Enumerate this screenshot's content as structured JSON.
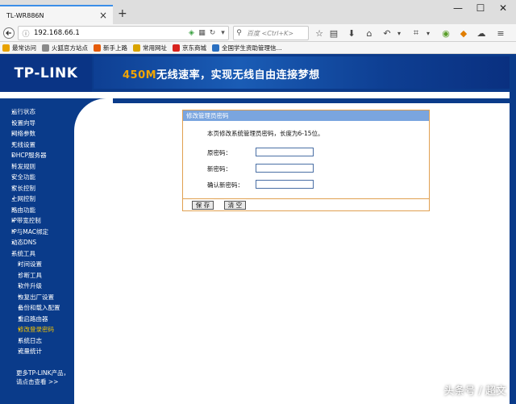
{
  "browser": {
    "tab_title": "TL-WR886N",
    "tab_close": "×",
    "new_tab": "+",
    "window_min": "—",
    "window_max": "☐",
    "window_close": "✕",
    "url": "192.168.66.1",
    "search_placeholder": "百度 <Ctrl+K>"
  },
  "bookmarks": [
    {
      "label": "最常访问",
      "icon": "star-folder-icon",
      "color": "#e8a200"
    },
    {
      "label": "火狐官方站点",
      "icon": "page-icon",
      "color": "#8a8a8a"
    },
    {
      "label": "新手上路",
      "icon": "firefox-icon",
      "color": "#e55b0a"
    },
    {
      "label": "常用网址",
      "icon": "folder-icon",
      "color": "#d9a400"
    },
    {
      "label": "京东商城",
      "icon": "jd-icon",
      "color": "#d8231e"
    },
    {
      "label": "全国学生资助管理信...",
      "icon": "globe-icon",
      "color": "#2a6fc0"
    }
  ],
  "banner": {
    "logo": "TP-LINK",
    "slogan_highlight": "450M",
    "slogan_rest": "无线速率，实现无线自由连接梦想"
  },
  "menu": [
    {
      "label": "运行状态",
      "sub": false
    },
    {
      "label": "设置向导",
      "sub": false
    },
    {
      "label": "网络参数",
      "sub": false
    },
    {
      "label": "无线设置",
      "sub": false
    },
    {
      "label": "DHCP服务器",
      "sub": false
    },
    {
      "label": "转发规则",
      "sub": false
    },
    {
      "label": "安全功能",
      "sub": false
    },
    {
      "label": "家长控制",
      "sub": false
    },
    {
      "label": "上网控制",
      "sub": false
    },
    {
      "label": "路由功能",
      "sub": false
    },
    {
      "label": "IP带宽控制",
      "sub": false
    },
    {
      "label": "IP与MAC绑定",
      "sub": false
    },
    {
      "label": "动态DNS",
      "sub": false
    },
    {
      "label": "系统工具",
      "sub": false,
      "expanded": true
    },
    {
      "label": "时间设置",
      "sub": true
    },
    {
      "label": "诊断工具",
      "sub": true
    },
    {
      "label": "软件升级",
      "sub": true
    },
    {
      "label": "恢复出厂设置",
      "sub": true
    },
    {
      "label": "备份和载入配置",
      "sub": true
    },
    {
      "label": "重启路由器",
      "sub": true
    },
    {
      "label": "修改登录密码",
      "sub": true,
      "active": true
    },
    {
      "label": "系统日志",
      "sub": true
    },
    {
      "label": "流量统计",
      "sub": true
    }
  ],
  "more": {
    "line1": "更多TP-LINK产品，",
    "line2": "请点击查看 >>"
  },
  "panel": {
    "title": "修改管理员密码",
    "description": "本页修改系统管理员密码，长度为6-15位。",
    "fields": [
      {
        "label": "原密码：",
        "value": ""
      },
      {
        "label": "新密码：",
        "value": ""
      },
      {
        "label": "确认新密码：",
        "value": ""
      }
    ],
    "save_label": "保 存",
    "clear_label": "清 空"
  },
  "watermark": "头条号 / 超文",
  "colors": {
    "nav_blue": "#0a3b8a",
    "panel_header": "#7aa5df",
    "panel_border": "#e0a050",
    "active_item": "#f2c200",
    "slogan_highlight": "#f2a500"
  }
}
